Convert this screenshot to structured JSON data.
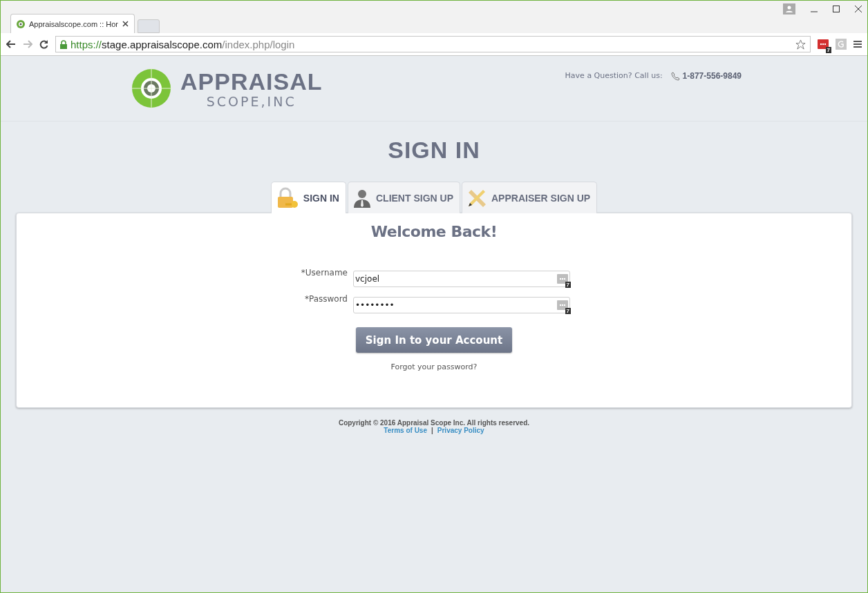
{
  "browser": {
    "tab_title": "Appraisalscope.com :: Hor",
    "url_secure": "https://",
    "url_host": "stage.appraisalscope.com",
    "url_path": "/index.php/login",
    "extension_badge": "7"
  },
  "header": {
    "logo_main": "APPRAISAL",
    "logo_sub": "SCOPE,INC",
    "question": "Have a Question? Call us:",
    "phone": "1-877-556-9849"
  },
  "page_title": "SIGN IN",
  "tabs": [
    {
      "kind": "lock",
      "label": "SIGN IN",
      "selected": true
    },
    {
      "kind": "person",
      "label": "CLIENT SIGN UP",
      "selected": false
    },
    {
      "kind": "pencil",
      "label": "APPRAISER SIGN UP",
      "selected": false
    }
  ],
  "form": {
    "heading": "Welcome Back!",
    "fields": [
      {
        "label": "*Username",
        "value": "vcjoel",
        "badge": "7"
      },
      {
        "label": "*Password",
        "value": "••••••••",
        "badge": "7"
      }
    ],
    "submit": "Sign In to your Account",
    "forgot": "Forgot your password?"
  },
  "footer": {
    "copyright": "Copyright © 2016 Appraisal Scope Inc. All rights reserved.",
    "links": [
      "Terms of Use",
      "Privacy Policy"
    ],
    "separator": "|"
  }
}
